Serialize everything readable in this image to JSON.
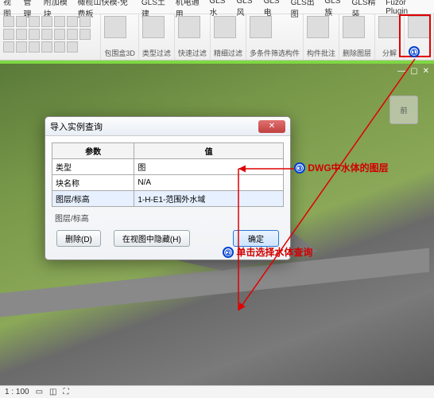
{
  "menu": [
    "视图",
    "管理",
    "附加模块",
    "橄榄山快模-免费板",
    "GLS土建",
    "机电通用",
    "GLS水",
    "GLS风",
    "GLS电",
    "GLS出图",
    "GLS族",
    "GLS精装",
    "Fuzor Plugin"
  ],
  "ribbon_groups": [
    "包围盒3D",
    "类型过滤",
    "快速过滤",
    "精细过滤",
    "多条件筛选构件",
    "构件批注",
    "删除图层",
    "分解"
  ],
  "dialog": {
    "title": "导入实例查询",
    "headers": [
      "参数",
      "值"
    ],
    "rows": [
      {
        "p": "类型",
        "v": "图"
      },
      {
        "p": "块名称",
        "v": "N/A"
      },
      {
        "p": "图层/标高",
        "v": "1-H-E1-范围外水域"
      }
    ],
    "subhead": "图层/标高",
    "btn_delete": "删除(D)",
    "btn_hide": "在视图中隐藏(H)",
    "btn_ok": "确定"
  },
  "annots": {
    "n1": "①",
    "n2": "②",
    "n2_text": "单击选择水体查询",
    "n3": "③",
    "n3_text": "DWG中水体的图层"
  },
  "navcube": "前",
  "status": {
    "scale": "1 : 100"
  },
  "wincontrols": [
    "—",
    "▢",
    "✕"
  ]
}
